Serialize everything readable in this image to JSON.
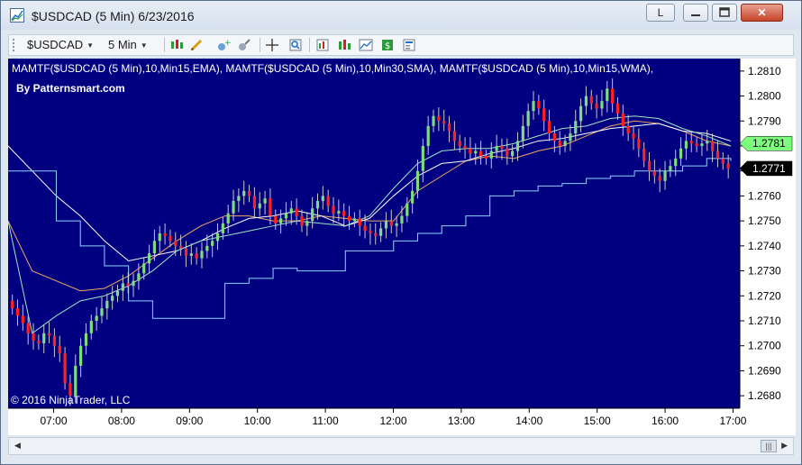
{
  "window": {
    "title": "$USDCAD (5 Min)  6/23/2016",
    "buttons": {
      "l_label": "L",
      "min_label": "",
      "max_label": "",
      "close_label": "✕"
    }
  },
  "toolbar": {
    "symbol": "$USDCAD",
    "interval": "5 Min",
    "icons": [
      "bar-type-icon",
      "draw-pencil-icon",
      "add-indicator-icon",
      "strategy-icon",
      "crosshair-icon",
      "zoom-icon",
      "data-box-icon",
      "chart-style-icon",
      "area-chart-icon",
      "money-icon",
      "properties-icon"
    ]
  },
  "chart_data": {
    "type": "candlestick",
    "indicator_label": "MAMTF($USDCAD  (5  Min),10,Min15,EMA),  MAMTF($USDCAD  (5  Min),10,Min30,SMA),  MAMTF($USDCAD  (5  Min),10,Min15,WMA),",
    "watermark_top": "By Patternsmart.com",
    "watermark_bottom": "© 2016 NinjaTrader, LLC",
    "x_tick_labels": [
      "07:00",
      "08:00",
      "09:00",
      "10:00",
      "11:00",
      "12:00",
      "13:00",
      "14:00",
      "15:00",
      "16:00",
      "17:00"
    ],
    "y_tick_labels": [
      "1.2810",
      "1.2800",
      "1.2790",
      "1.2780",
      "1.2770",
      "1.2760",
      "1.2750",
      "1.2740",
      "1.2730",
      "1.2720",
      "1.2710",
      "1.2700",
      "1.2690",
      "1.2680"
    ],
    "y_ticks": [
      1.281,
      1.28,
      1.279,
      1.278,
      1.277,
      1.276,
      1.275,
      1.274,
      1.273,
      1.272,
      1.271,
      1.27,
      1.269,
      1.268
    ],
    "ylim": [
      1.2675,
      1.2815
    ],
    "x_start_hour": 6.33,
    "x_end_hour": 17.1,
    "bar_minutes": 5,
    "closes": [
      1.2715,
      1.2712,
      1.2709,
      1.2705,
      1.2702,
      1.2701,
      1.2705,
      1.2704,
      1.27,
      1.2697,
      1.2685,
      1.268,
      1.2692,
      1.27,
      1.2705,
      1.271,
      1.2712,
      1.2715,
      1.2718,
      1.272,
      1.2722,
      1.2725,
      1.2724,
      1.2726,
      1.2729,
      1.2733,
      1.2737,
      1.2742,
      1.2745,
      1.2744,
      1.2742,
      1.274,
      1.2739,
      1.2736,
      1.2737,
      1.2735,
      1.2738,
      1.274,
      1.2742,
      1.2745,
      1.2749,
      1.2753,
      1.2758,
      1.276,
      1.2762,
      1.276,
      1.2755,
      1.2757,
      1.2759,
      1.2752,
      1.2749,
      1.2751,
      1.2753,
      1.2755,
      1.2752,
      1.2748,
      1.275,
      1.2755,
      1.2758,
      1.276,
      1.2756,
      1.2753,
      1.2754,
      1.2752,
      1.275,
      1.2751,
      1.2748,
      1.2746,
      1.2745,
      1.2744,
      1.2747,
      1.275,
      1.2748,
      1.2749,
      1.2752,
      1.2757,
      1.2762,
      1.277,
      1.278,
      1.2788,
      1.2792,
      1.279,
      1.2789,
      1.2786,
      1.2782,
      1.278,
      1.2779,
      1.2777,
      1.2778,
      1.2776,
      1.2775,
      1.2778,
      1.278,
      1.2779,
      1.2776,
      1.2778,
      1.2782,
      1.2788,
      1.2794,
      1.2798,
      1.2795,
      1.279,
      1.2785,
      1.2782,
      1.278,
      1.2782,
      1.2785,
      1.279,
      1.2796,
      1.28,
      1.2797,
      1.2795,
      1.2798,
      1.2803,
      1.2797,
      1.2793,
      1.2788,
      1.2785,
      1.2783,
      1.2779,
      1.2774,
      1.277,
      1.2768,
      1.2766,
      1.277,
      1.2772,
      1.2775,
      1.2779,
      1.2782,
      1.2781,
      1.278,
      1.2781,
      1.2782,
      1.2778,
      1.2775,
      1.2773,
      1.2771
    ],
    "series": [
      {
        "name": "",
        "color": "#f4a460",
        "values": [
          1.275,
          1.273,
          1.2726,
          1.2722,
          1.2723,
          1.2728,
          1.2735,
          1.2742,
          1.2748,
          1.2752,
          1.2752,
          1.275,
          1.275,
          1.2752,
          1.2751,
          1.275,
          1.275,
          1.2762,
          1.2768,
          1.2774,
          1.2776,
          1.2775,
          1.2778,
          1.278,
          1.2784,
          1.2788,
          1.279,
          1.2789,
          1.2786,
          1.2782,
          1.278
        ]
      },
      {
        "name": "",
        "color": "#ffffff",
        "values": [
          1.278,
          1.277,
          1.276,
          1.2752,
          1.2742,
          1.2734,
          1.2736,
          1.2738,
          1.2742,
          1.2747,
          1.2751,
          1.2752,
          1.2754,
          1.2752,
          1.2748,
          1.2751,
          1.276,
          1.2768,
          1.2773,
          1.2774,
          1.2777,
          1.2779,
          1.2782,
          1.2783,
          1.2785,
          1.2787,
          1.2788,
          1.2789,
          1.2786,
          1.2785,
          1.2782
        ]
      },
      {
        "name": "",
        "color": "#9fe8c0",
        "values": [
          1.275,
          1.2705,
          1.2712,
          1.2718,
          1.272,
          1.2724,
          1.273,
          1.2738,
          1.2742,
          1.2744,
          1.2746,
          1.2748,
          1.275,
          1.2749,
          1.2748,
          1.2752,
          1.2763,
          1.2773,
          1.2778,
          1.2779,
          1.2779,
          1.2781,
          1.2784,
          1.2787,
          1.2788,
          1.2791,
          1.2792,
          1.2791,
          1.2787,
          1.2784,
          1.278
        ]
      }
    ],
    "lower_line": {
      "color": "#8fd3ff",
      "values": [
        1.277,
        1.277,
        1.275,
        1.274,
        1.2732,
        1.2718,
        1.2711,
        1.2711,
        1.2711,
        1.2725,
        1.2727,
        1.2731,
        1.273,
        1.273,
        1.2738,
        1.2738,
        1.2742,
        1.2745,
        1.2748,
        1.2752,
        1.276,
        1.2762,
        1.2764,
        1.2765,
        1.2767,
        1.2768,
        1.277,
        1.277,
        1.2772,
        1.2775,
        1.2774
      ]
    },
    "price_markers": [
      {
        "value": "1.2781",
        "bg": "#7dff7d",
        "fg": "#000000"
      },
      {
        "value": "1.2771",
        "bg": "#000000",
        "fg": "#ffffff"
      }
    ],
    "colors": {
      "background": "#000080",
      "up": "#7ddc7d",
      "down": "#ff2020",
      "wick": "#c8c8c8",
      "text": "#ffffff",
      "axis_bg": "#ffffff"
    }
  }
}
